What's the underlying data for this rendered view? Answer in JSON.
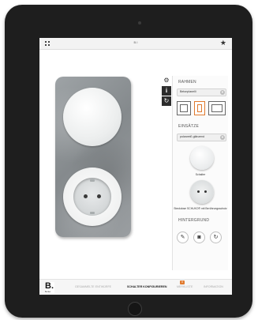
{
  "app": {
    "title": "B.I"
  },
  "config_panel": {
    "frame_section": {
      "title": "RAHMEN",
      "material_selected": "Betonplanelli"
    },
    "inserts_section": {
      "title": "EINSÄTZE",
      "color_selected": "polarweiß glänzend",
      "switch_label": "Schalter",
      "socket_label": "Steckdose SCHUKO® mit Berührungsschutz"
    },
    "background_section": {
      "title": "HINTERGRUND"
    }
  },
  "bottom_nav": {
    "logo_letter": "B.",
    "logo_sub": "Berker",
    "items": [
      {
        "label": "GESAMMELTE ENTWÜRFE",
        "active": false
      },
      {
        "label": "SCHALTER KONFIGURIEREN",
        "active": true
      },
      {
        "label": "MERKLISTE",
        "active": false,
        "badge": "0"
      },
      {
        "label": "INFORMATION",
        "active": false
      }
    ]
  },
  "icons": {
    "menu": "grid-icon",
    "favorite": "star-icon",
    "settings": "gear-icon",
    "info": "info-icon",
    "reset": "refresh-icon",
    "bg_tool": "brush-icon",
    "bg_camera": "camera-icon",
    "bg_reset": "refresh-icon"
  }
}
